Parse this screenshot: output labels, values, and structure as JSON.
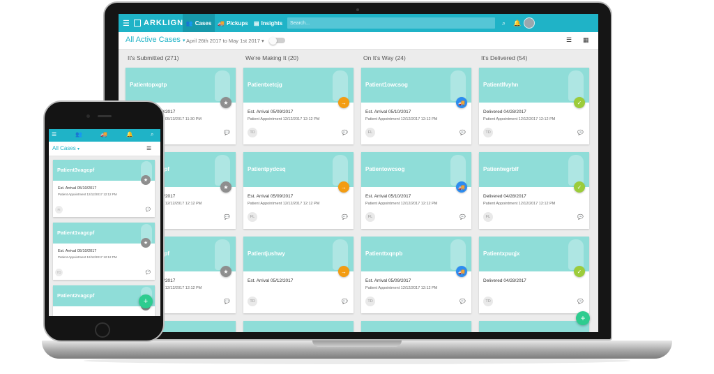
{
  "header": {
    "brand": "ARKLIGN",
    "tabs": [
      {
        "label": "Cases",
        "icon": "people-icon"
      },
      {
        "label": "Pickups",
        "icon": "truck-icon"
      },
      {
        "label": "Insights",
        "icon": "chart-icon"
      }
    ],
    "search_placeholder": "Search..."
  },
  "toolbar": {
    "filter_label": "All Active Cases",
    "date_range": "April 26th 2017 to May 1st 2017"
  },
  "columns": [
    {
      "title": "It's Submitted (271)",
      "status_color": "#8e8e8e",
      "status_icon": "star-icon",
      "cards": [
        {
          "patient": "Patientopxgtp",
          "line1": "Est. Arrival 05/10/2017",
          "line2": "Patient Appointment 05/13/2017 11:30 PM",
          "initials": ""
        },
        {
          "patient": "Patient3vagcpf",
          "line1": "Est. Arrival 05/10/2017",
          "line2": "Patient Appointment 12/12/2017 12:12 PM",
          "initials": ""
        },
        {
          "patient": "Patient1vagcpf",
          "line1": "Est. Arrival 05/10/2017",
          "line2": "Patient Appointment 12/12/2017 12:12 PM",
          "initials": ""
        }
      ]
    },
    {
      "title": "We're Making It (20)",
      "status_color": "#f39c12",
      "status_icon": "arrow-icon",
      "cards": [
        {
          "patient": "Patientxetcjg",
          "line1": "Est. Arrival 05/09/2017",
          "line2": "Patient Appointment 12/12/2017 12:12 PM",
          "initials": "TD"
        },
        {
          "patient": "Patientpydcsq",
          "line1": "Est. Arrival 05/09/2017",
          "line2": "Patient Appointment 12/12/2017 12:12 PM",
          "initials": "FL"
        },
        {
          "patient": "Patientjushwy",
          "line1": "Est. Arrival 05/12/2017",
          "line2": "",
          "initials": "TD"
        }
      ]
    },
    {
      "title": "On It's Way (24)",
      "status_color": "#2d8cf0",
      "status_icon": "truck-icon",
      "cards": [
        {
          "patient": "Patient1owcsog",
          "line1": "Est. Arrival 05/10/2017",
          "line2": "Patient Appointment 12/12/2017 12:12 PM",
          "initials": "FL"
        },
        {
          "patient": "Patientowcsog",
          "line1": "Est. Arrival 05/10/2017",
          "line2": "Patient Appointment 12/12/2017 12:12 PM",
          "initials": "FL"
        },
        {
          "patient": "Patienttxqnpb",
          "line1": "Est. Arrival 05/09/2017",
          "line2": "Patient Appointment 12/12/2017 12:12 PM",
          "initials": "TD"
        }
      ]
    },
    {
      "title": "It's Delivered (54)",
      "status_color": "#9ccc3a",
      "status_icon": "check-icon",
      "cards": [
        {
          "patient": "Patientlfvyhn",
          "line1": "Delivered 04/28/2017",
          "line2": "Patient Appointment 12/12/2017 12:12 PM",
          "initials": "TD"
        },
        {
          "patient": "Patientwgrblf",
          "line1": "Delivered 04/28/2017",
          "line2": "Patient Appointment 12/12/2017 12:12 PM",
          "initials": "FL"
        },
        {
          "patient": "Patientxpuqjx",
          "line1": "Delivered 04/28/2017",
          "line2": "",
          "initials": "TD"
        }
      ]
    }
  ],
  "phone": {
    "filter_label": "All Cases",
    "cards": [
      {
        "patient": "Patient3vagcpf",
        "line1": "Est. Arrival 05/10/2017",
        "line2": "Patient Appointment 12/12/2017 12:12 PM",
        "initials": "FI"
      },
      {
        "patient": "Patient1vagcpf",
        "line1": "Est. Arrival 05/10/2017",
        "line2": "Patient Appointment 12/12/2017 12:12 PM",
        "initials": "TD"
      },
      {
        "patient": "Patient2vagcpf",
        "line1": "",
        "line2": "",
        "initials": ""
      }
    ]
  },
  "colors": {
    "brand": "#1fb3c7",
    "card_band": "#8fddd8",
    "fab": "#2ecc8f"
  }
}
